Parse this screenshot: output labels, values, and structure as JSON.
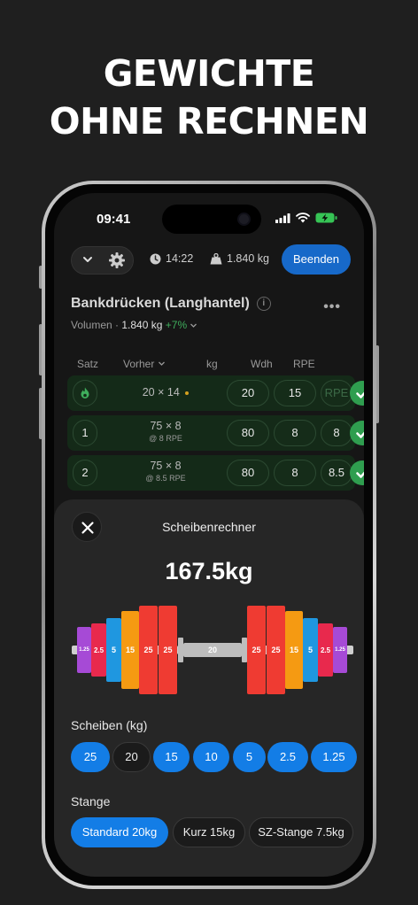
{
  "headline": {
    "line1": "GEWICHTE",
    "line2": "OHNE RECHNEN"
  },
  "status_bar": {
    "time": "09:41"
  },
  "toolbar": {
    "timer": "14:22",
    "volume_total": "1.840 kg",
    "finish_label": "Beenden"
  },
  "exercise": {
    "title": "Bankdrücken (Langhantel)",
    "volume_label": "Volumen · ",
    "volume_value": "1.840 kg",
    "volume_change": "+7%"
  },
  "table": {
    "headers": {
      "set": "Satz",
      "previous": "Vorher",
      "kg": "kg",
      "reps": "Wdh",
      "rpe": "RPE"
    },
    "rows": [
      {
        "set": "",
        "previous": "20 × 14",
        "previous_sub": "",
        "kg": "20",
        "reps": "15",
        "rpe": "RPE",
        "warmup": true
      },
      {
        "set": "1",
        "previous": "75 × 8",
        "previous_sub": "@ 8 RPE",
        "kg": "80",
        "reps": "8",
        "rpe": "8"
      },
      {
        "set": "2",
        "previous": "75 × 8",
        "previous_sub": "@ 8.5 RPE",
        "kg": "80",
        "reps": "8",
        "rpe": "8.5"
      }
    ]
  },
  "sheet": {
    "title": "Scheibenrechner",
    "total": "167.5kg",
    "bar_label": "20",
    "plates_left": [
      "1.25",
      "2.5",
      "5",
      "15",
      "25",
      "25"
    ],
    "plates_right": [
      "25",
      "25",
      "15",
      "5",
      "2.5",
      "1.25"
    ],
    "plate_section_label": "Scheiben (kg)",
    "plate_chips": [
      {
        "label": "25",
        "selected": true
      },
      {
        "label": "20",
        "selected": false
      },
      {
        "label": "15",
        "selected": true
      },
      {
        "label": "10",
        "selected": true
      },
      {
        "label": "5",
        "selected": true
      },
      {
        "label": "2.5",
        "selected": true
      },
      {
        "label": "1.25",
        "selected": true
      }
    ],
    "bar_section_label": "Stange",
    "bar_chips": [
      {
        "label": "Standard 20kg",
        "selected": true
      },
      {
        "label": "Kurz 15kg",
        "selected": false
      },
      {
        "label": "SZ-Stange 7.5kg",
        "selected": false
      }
    ]
  },
  "colors": {
    "accent": "#137de6",
    "success": "#2f9e4f",
    "plate_25": "#ef3b32",
    "plate_15": "#f59a12",
    "plate_5": "#1f97e0",
    "plate_2_5": "#e8294d",
    "plate_1_25": "#a64ad6"
  }
}
